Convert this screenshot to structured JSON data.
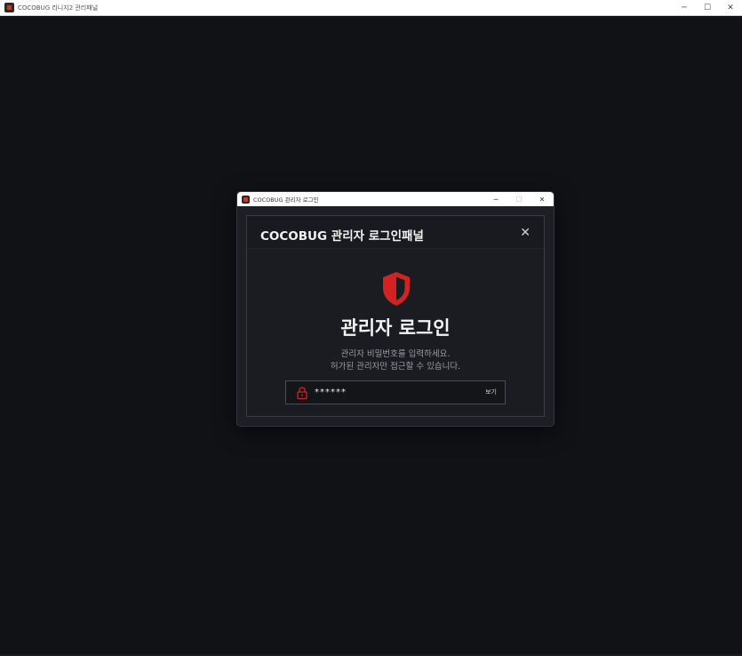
{
  "main_window": {
    "title": "COCOBUG 리니지2 관리패널",
    "controls": {
      "minimize": "─",
      "maximize": "☐",
      "close": "✕"
    }
  },
  "dialog": {
    "title": "COCOBUG 관리자 로그인",
    "controls": {
      "minimize": "─",
      "maximize": "☐",
      "close": "✕"
    },
    "panel": {
      "title": "COCOBUG 관리자 로그인패널",
      "close": "✕",
      "icon": "shield-icon",
      "heading": "관리자 로그인",
      "desc_line1": "관리자 비밀번호를 입력하세요.",
      "desc_line2": "허가된 관리자만 접근할 수 있습니다.",
      "password": {
        "value": "******",
        "icon": "lock-icon",
        "show_label": "보기"
      }
    }
  },
  "colors": {
    "background": "#111216",
    "accent": "#d32222",
    "panel": "#1b1c21"
  }
}
